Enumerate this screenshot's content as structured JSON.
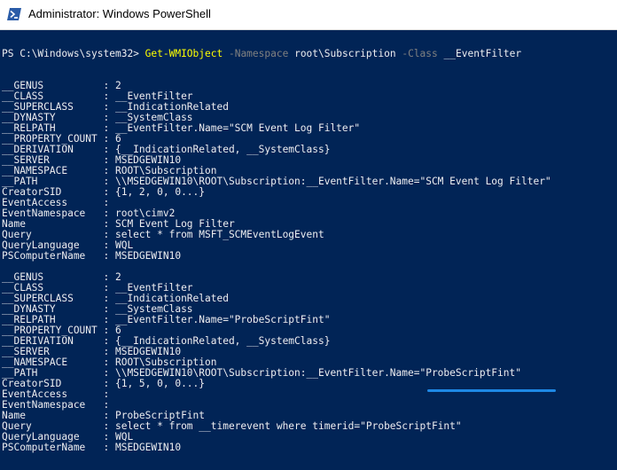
{
  "window": {
    "title": "Administrator: Windows PowerShell",
    "icon": "powershell-icon"
  },
  "colors": {
    "console_bg": "#012456",
    "text": "#eeedf0",
    "cmdlet": "#ffff00",
    "parameter": "#808080",
    "annotation": "#1e88e5"
  },
  "command": {
    "prompt": "PS C:\\Windows\\system32> ",
    "cmdlet": "Get-WMIObject",
    "param1": "-Namespace",
    "arg1": "root\\Subscription",
    "param2": "-Class",
    "arg2": "__EventFilter"
  },
  "output": [
    "__GENUS          : 2",
    "__CLASS          : __EventFilter",
    "__SUPERCLASS     : __IndicationRelated",
    "__DYNASTY        : __SystemClass",
    "__RELPATH        : __EventFilter.Name=\"SCM Event Log Filter\"",
    "__PROPERTY_COUNT : 6",
    "__DERIVATION     : {__IndicationRelated, __SystemClass}",
    "__SERVER         : MSEDGEWIN10",
    "__NAMESPACE      : ROOT\\Subscription",
    "__PATH           : \\\\MSEDGEWIN10\\ROOT\\Subscription:__EventFilter.Name=\"SCM Event Log Filter\"",
    "CreatorSID       : {1, 2, 0, 0...}",
    "EventAccess      :",
    "EventNamespace   : root\\cimv2",
    "Name             : SCM Event Log Filter",
    "Query            : select * from MSFT_SCMEventLogEvent",
    "QueryLanguage    : WQL",
    "PSComputerName   : MSEDGEWIN10",
    "__GENUS          : 2",
    "__CLASS          : __EventFilter",
    "__SUPERCLASS     : __IndicationRelated",
    "__DYNASTY        : __SystemClass",
    "__RELPATH        : __EventFilter.Name=\"ProbeScriptFint\"",
    "__PROPERTY_COUNT : 6",
    "__DERIVATION     : {__IndicationRelated, __SystemClass}",
    "__SERVER         : MSEDGEWIN10",
    "__NAMESPACE      : ROOT\\Subscription",
    "__PATH           : \\\\MSEDGEWIN10\\ROOT\\Subscription:__EventFilter.Name=\"ProbeScriptFint\"",
    "CreatorSID       : {1, 5, 0, 0...}",
    "EventAccess      :",
    "EventNamespace   :",
    "Name             : ProbeScriptFint",
    "Query            : select * from __timerevent where timerid=\"ProbeScriptFint\"",
    "QueryLanguage    : WQL",
    "PSComputerName   : MSEDGEWIN10"
  ]
}
